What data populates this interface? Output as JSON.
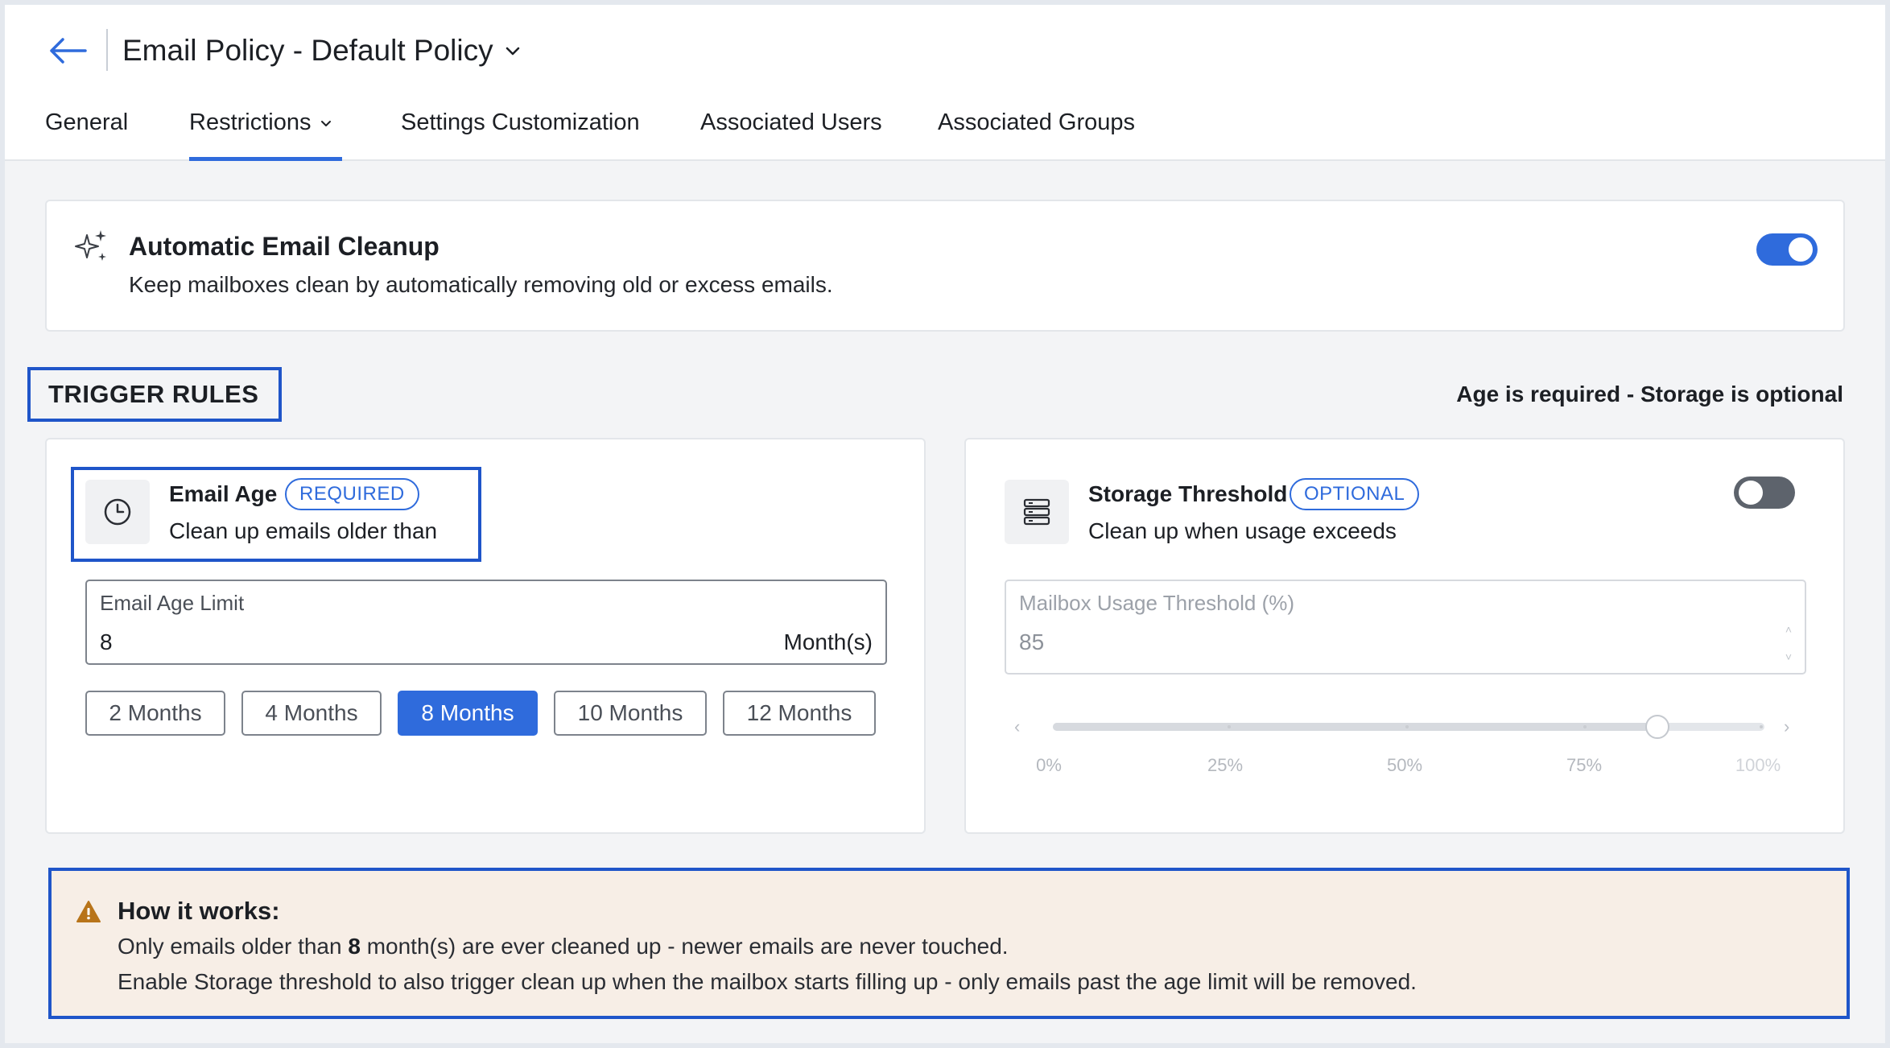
{
  "header": {
    "title": "Email Policy - Default Policy",
    "back_icon": "arrow-left-icon",
    "tabs": [
      {
        "label": "General"
      },
      {
        "label": "Restrictions",
        "active": true
      },
      {
        "label": "Settings Customization"
      },
      {
        "label": "Associated Users"
      },
      {
        "label": "Associated Groups"
      }
    ]
  },
  "cleanup": {
    "title": "Automatic Email Cleanup",
    "description": "Keep mailboxes clean by automatically removing old or excess emails.",
    "enabled": true
  },
  "trigger_rules": {
    "heading": "TRIGGER RULES",
    "hint": "Age is required - Storage is optional",
    "email_age": {
      "title": "Email Age",
      "badge": "REQUIRED",
      "subtitle": "Clean up emails older than",
      "field_label": "Email Age Limit",
      "value": "8",
      "unit": "Month(s)",
      "presets": [
        "2 Months",
        "4 Months",
        "8 Months",
        "10 Months",
        "12 Months"
      ],
      "selected_preset": "8 Months"
    },
    "storage": {
      "title": "Storage Threshold",
      "badge": "OPTIONAL",
      "subtitle": "Clean up when usage exceeds",
      "enabled": false,
      "field_label": "Mailbox Usage Threshold (%)",
      "value": "85",
      "slider_value_percent": 85,
      "ticks": [
        "0%",
        "25%",
        "50%",
        "75%",
        "100%"
      ]
    }
  },
  "info": {
    "title": "How it works:",
    "line1_prefix": "Only emails older than ",
    "line1_value": "8",
    "line1_suffix": " month(s) are ever cleaned up - newer emails are never touched.",
    "line2": "Enable Storage threshold to also trigger clean up when the mailbox starts filling up - only emails past the age limit will be removed."
  },
  "colors": {
    "accent": "#2f6bdc",
    "highlight_border": "#1f55c9",
    "info_background": "#f7eee6",
    "warning_icon": "#b8741a"
  }
}
